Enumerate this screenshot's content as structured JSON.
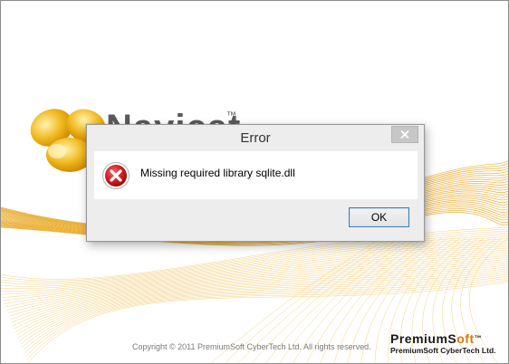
{
  "splash": {
    "product_name": "Navicat",
    "trademark": "™",
    "copyright": "Copyright © 2011  PremiumSoft CyberTech Ltd. All rights reserved.",
    "vendor_brand_head": "PremiumS",
    "vendor_brand_tail": "oft",
    "vendor_trademark": "™",
    "vendor_company": "PremiumSoft CyberTech Ltd.",
    "accent_color": "#e8a317"
  },
  "dialog": {
    "title": "Error",
    "message": "Missing required library sqlite.dll",
    "ok_label": "OK",
    "icon": "error-icon",
    "close_icon": "close-icon"
  }
}
